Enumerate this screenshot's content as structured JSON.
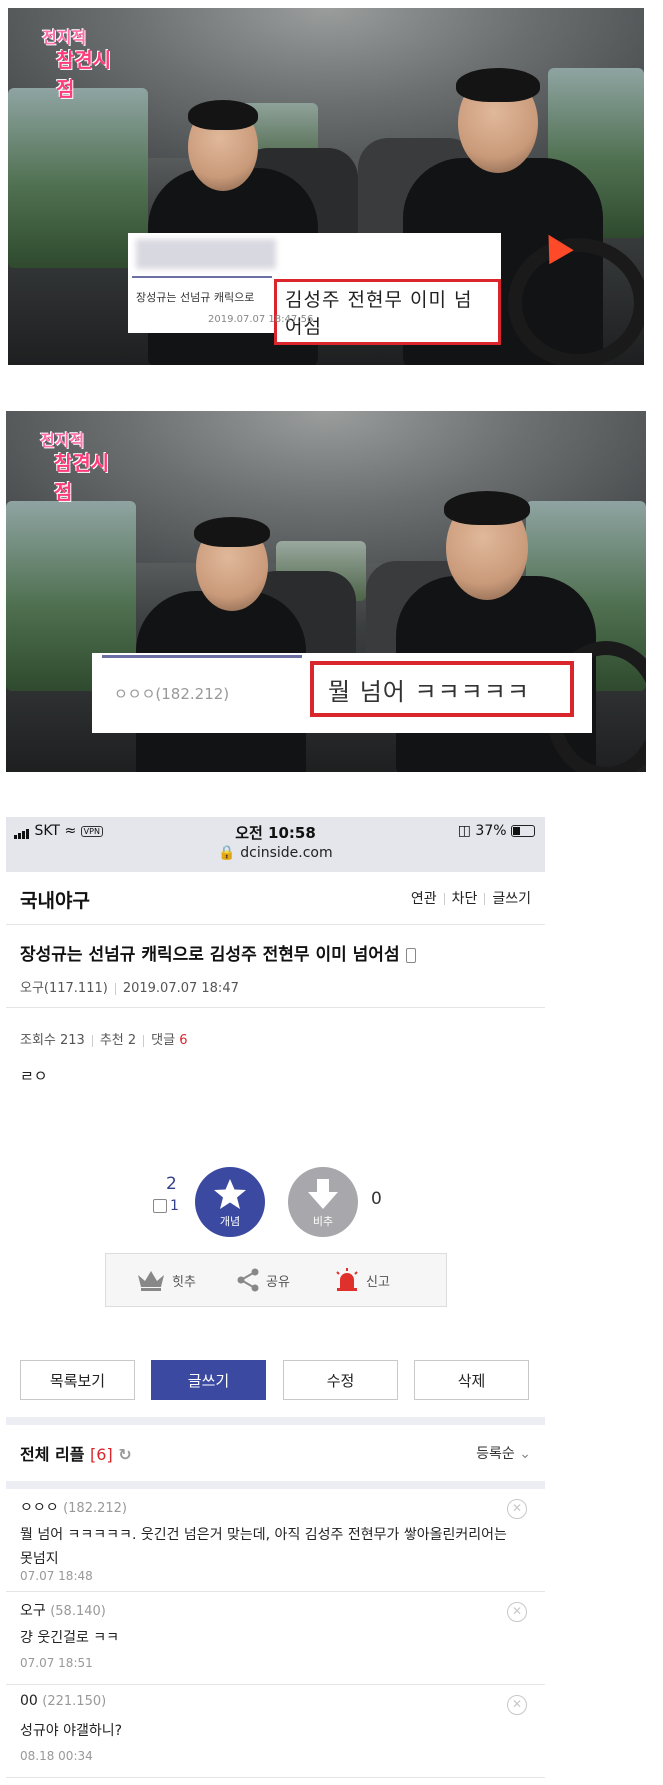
{
  "video1": {
    "logo_line1": "전지적",
    "logo_line2": "참견시점",
    "caption_small": "장성규는 선넘규 캐릭으로",
    "caption_big": "김성주 전현무 이미 넘어섬",
    "caption_date": "2019.07.07 18:47:56"
  },
  "video2": {
    "logo_line1": "전지적",
    "logo_line2": "참견시점",
    "caption_anon": "ㅇㅇㅇ(182.212)",
    "caption_big": "뭘 넘어 ㅋㅋㅋㅋㅋ"
  },
  "status": {
    "carrier": "SKT",
    "vpn": "VPN",
    "time": "오전 10:58",
    "battery": "37%",
    "url": "dcinside.com"
  },
  "gallery": {
    "name": "국내야구",
    "links": [
      "연관",
      "차단",
      "글쓰기"
    ]
  },
  "post": {
    "title": "장성규는 선넘규 캐릭으로 김성주 전현무 이미 넘어섬",
    "author": "오구(117.111)",
    "date": "2019.07.07 18:47",
    "views_label": "조회수 213",
    "recommend_label": "추천 2",
    "comments_label": "댓글",
    "comments_count": "6",
    "body": "ㄹㅇ"
  },
  "recommend": {
    "up_count": "2",
    "fixed_count": "1",
    "up_label": "개념",
    "down_label": "비추",
    "down_count": "0"
  },
  "actions": {
    "hit": "힛추",
    "share": "공유",
    "report": "신고"
  },
  "buttons": {
    "list": "목록보기",
    "write": "글쓰기",
    "edit": "수정",
    "delete": "삭제"
  },
  "comments_header": {
    "title": "전체 리플",
    "count": "[6]",
    "sort": "등록순"
  },
  "comments": [
    {
      "nick": "ㅇㅇㅇ",
      "ip": "(182.212)",
      "text": "뭘 넘어 ㅋㅋㅋㅋㅋ. 웃긴건 넘은거 맞는데, 아직 김성주 전현무가 쌓아올린커리어는 못넘지",
      "date": "07.07 18:48"
    },
    {
      "nick": "오구",
      "ip": "(58.140)",
      "text": "걍 웃긴걸로 ㅋㅋ",
      "date": "07.07 18:51"
    },
    {
      "nick": "00",
      "ip": "(221.150)",
      "text": "성규야 야갤하니?",
      "date": "08.18 00:34"
    }
  ],
  "colors": {
    "accent": "#3b4aa0",
    "red": "#d9262c"
  }
}
